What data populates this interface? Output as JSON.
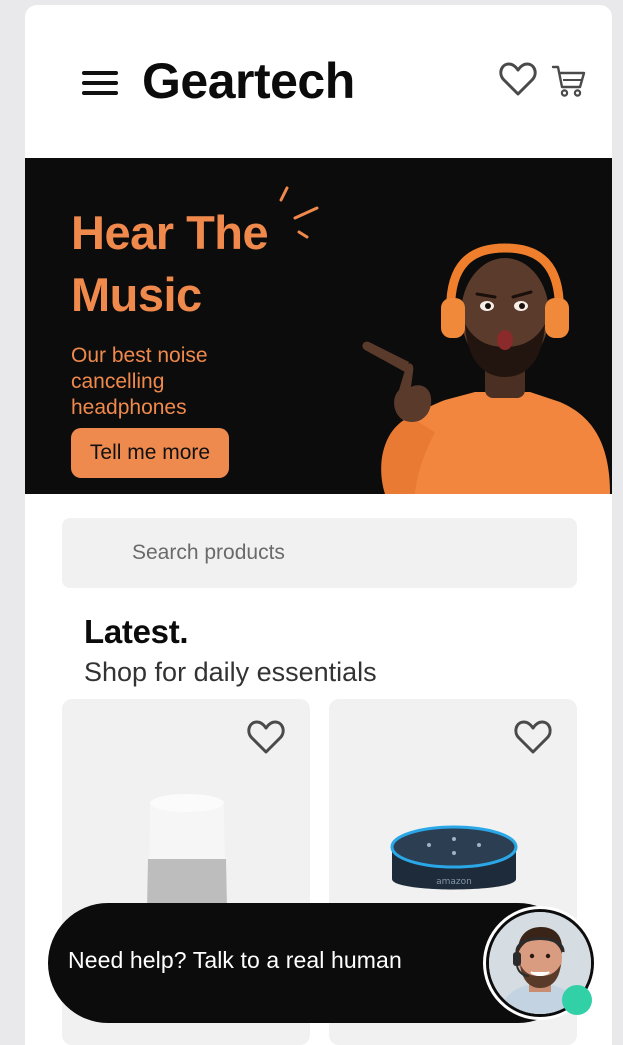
{
  "header": {
    "brand": "Geartech",
    "menu_icon": "hamburger-menu-icon",
    "wishlist_icon": "heart-icon",
    "cart_icon": "shopping-cart-icon"
  },
  "hero": {
    "title_line1": "Hear The",
    "title_line2": "Music",
    "subtitle": "Our best noise cancelling headphones",
    "button_label": "Tell me more",
    "accent_color": "#f0894c",
    "background_color": "#0c0c0c"
  },
  "search": {
    "placeholder": "Search products",
    "value": ""
  },
  "latest": {
    "title": "Latest.",
    "subtitle": "Shop for daily essentials",
    "products": [
      {
        "name": "smart-speaker-white",
        "favorite_icon": "heart-outline-icon"
      },
      {
        "name": "amazon-echo-dot",
        "favorite_icon": "heart-outline-icon"
      }
    ],
    "product_badge_text": "amazon"
  },
  "help_bar": {
    "text": "Need help? Talk to a real human",
    "status_color": "#31d0a6"
  }
}
